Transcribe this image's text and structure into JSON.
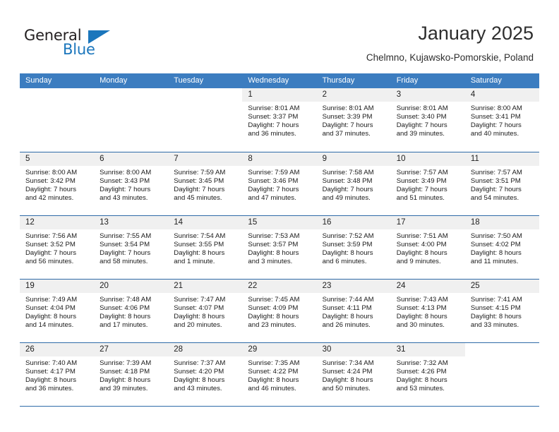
{
  "logo": {
    "word1": "General",
    "word2": "Blue",
    "brand_color": "#1b76bc"
  },
  "header": {
    "title": "January 2025",
    "location": "Chelmno, Kujawsko-Pomorskie, Poland"
  },
  "calendar": {
    "header_bg": "#3c7dc0",
    "weekdays": [
      "Sunday",
      "Monday",
      "Tuesday",
      "Wednesday",
      "Thursday",
      "Friday",
      "Saturday"
    ],
    "weeks": [
      [
        {
          "day": "",
          "lines": []
        },
        {
          "day": "",
          "lines": []
        },
        {
          "day": "",
          "lines": []
        },
        {
          "day": "1",
          "lines": [
            "Sunrise: 8:01 AM",
            "Sunset: 3:37 PM",
            "Daylight: 7 hours",
            "and 36 minutes."
          ]
        },
        {
          "day": "2",
          "lines": [
            "Sunrise: 8:01 AM",
            "Sunset: 3:39 PM",
            "Daylight: 7 hours",
            "and 37 minutes."
          ]
        },
        {
          "day": "3",
          "lines": [
            "Sunrise: 8:01 AM",
            "Sunset: 3:40 PM",
            "Daylight: 7 hours",
            "and 39 minutes."
          ]
        },
        {
          "day": "4",
          "lines": [
            "Sunrise: 8:00 AM",
            "Sunset: 3:41 PM",
            "Daylight: 7 hours",
            "and 40 minutes."
          ]
        }
      ],
      [
        {
          "day": "5",
          "lines": [
            "Sunrise: 8:00 AM",
            "Sunset: 3:42 PM",
            "Daylight: 7 hours",
            "and 42 minutes."
          ]
        },
        {
          "day": "6",
          "lines": [
            "Sunrise: 8:00 AM",
            "Sunset: 3:43 PM",
            "Daylight: 7 hours",
            "and 43 minutes."
          ]
        },
        {
          "day": "7",
          "lines": [
            "Sunrise: 7:59 AM",
            "Sunset: 3:45 PM",
            "Daylight: 7 hours",
            "and 45 minutes."
          ]
        },
        {
          "day": "8",
          "lines": [
            "Sunrise: 7:59 AM",
            "Sunset: 3:46 PM",
            "Daylight: 7 hours",
            "and 47 minutes."
          ]
        },
        {
          "day": "9",
          "lines": [
            "Sunrise: 7:58 AM",
            "Sunset: 3:48 PM",
            "Daylight: 7 hours",
            "and 49 minutes."
          ]
        },
        {
          "day": "10",
          "lines": [
            "Sunrise: 7:57 AM",
            "Sunset: 3:49 PM",
            "Daylight: 7 hours",
            "and 51 minutes."
          ]
        },
        {
          "day": "11",
          "lines": [
            "Sunrise: 7:57 AM",
            "Sunset: 3:51 PM",
            "Daylight: 7 hours",
            "and 54 minutes."
          ]
        }
      ],
      [
        {
          "day": "12",
          "lines": [
            "Sunrise: 7:56 AM",
            "Sunset: 3:52 PM",
            "Daylight: 7 hours",
            "and 56 minutes."
          ]
        },
        {
          "day": "13",
          "lines": [
            "Sunrise: 7:55 AM",
            "Sunset: 3:54 PM",
            "Daylight: 7 hours",
            "and 58 minutes."
          ]
        },
        {
          "day": "14",
          "lines": [
            "Sunrise: 7:54 AM",
            "Sunset: 3:55 PM",
            "Daylight: 8 hours",
            "and 1 minute."
          ]
        },
        {
          "day": "15",
          "lines": [
            "Sunrise: 7:53 AM",
            "Sunset: 3:57 PM",
            "Daylight: 8 hours",
            "and 3 minutes."
          ]
        },
        {
          "day": "16",
          "lines": [
            "Sunrise: 7:52 AM",
            "Sunset: 3:59 PM",
            "Daylight: 8 hours",
            "and 6 minutes."
          ]
        },
        {
          "day": "17",
          "lines": [
            "Sunrise: 7:51 AM",
            "Sunset: 4:00 PM",
            "Daylight: 8 hours",
            "and 9 minutes."
          ]
        },
        {
          "day": "18",
          "lines": [
            "Sunrise: 7:50 AM",
            "Sunset: 4:02 PM",
            "Daylight: 8 hours",
            "and 11 minutes."
          ]
        }
      ],
      [
        {
          "day": "19",
          "lines": [
            "Sunrise: 7:49 AM",
            "Sunset: 4:04 PM",
            "Daylight: 8 hours",
            "and 14 minutes."
          ]
        },
        {
          "day": "20",
          "lines": [
            "Sunrise: 7:48 AM",
            "Sunset: 4:06 PM",
            "Daylight: 8 hours",
            "and 17 minutes."
          ]
        },
        {
          "day": "21",
          "lines": [
            "Sunrise: 7:47 AM",
            "Sunset: 4:07 PM",
            "Daylight: 8 hours",
            "and 20 minutes."
          ]
        },
        {
          "day": "22",
          "lines": [
            "Sunrise: 7:45 AM",
            "Sunset: 4:09 PM",
            "Daylight: 8 hours",
            "and 23 minutes."
          ]
        },
        {
          "day": "23",
          "lines": [
            "Sunrise: 7:44 AM",
            "Sunset: 4:11 PM",
            "Daylight: 8 hours",
            "and 26 minutes."
          ]
        },
        {
          "day": "24",
          "lines": [
            "Sunrise: 7:43 AM",
            "Sunset: 4:13 PM",
            "Daylight: 8 hours",
            "and 30 minutes."
          ]
        },
        {
          "day": "25",
          "lines": [
            "Sunrise: 7:41 AM",
            "Sunset: 4:15 PM",
            "Daylight: 8 hours",
            "and 33 minutes."
          ]
        }
      ],
      [
        {
          "day": "26",
          "lines": [
            "Sunrise: 7:40 AM",
            "Sunset: 4:17 PM",
            "Daylight: 8 hours",
            "and 36 minutes."
          ]
        },
        {
          "day": "27",
          "lines": [
            "Sunrise: 7:39 AM",
            "Sunset: 4:18 PM",
            "Daylight: 8 hours",
            "and 39 minutes."
          ]
        },
        {
          "day": "28",
          "lines": [
            "Sunrise: 7:37 AM",
            "Sunset: 4:20 PM",
            "Daylight: 8 hours",
            "and 43 minutes."
          ]
        },
        {
          "day": "29",
          "lines": [
            "Sunrise: 7:35 AM",
            "Sunset: 4:22 PM",
            "Daylight: 8 hours",
            "and 46 minutes."
          ]
        },
        {
          "day": "30",
          "lines": [
            "Sunrise: 7:34 AM",
            "Sunset: 4:24 PM",
            "Daylight: 8 hours",
            "and 50 minutes."
          ]
        },
        {
          "day": "31",
          "lines": [
            "Sunrise: 7:32 AM",
            "Sunset: 4:26 PM",
            "Daylight: 8 hours",
            "and 53 minutes."
          ]
        },
        {
          "day": "",
          "lines": []
        }
      ]
    ]
  }
}
